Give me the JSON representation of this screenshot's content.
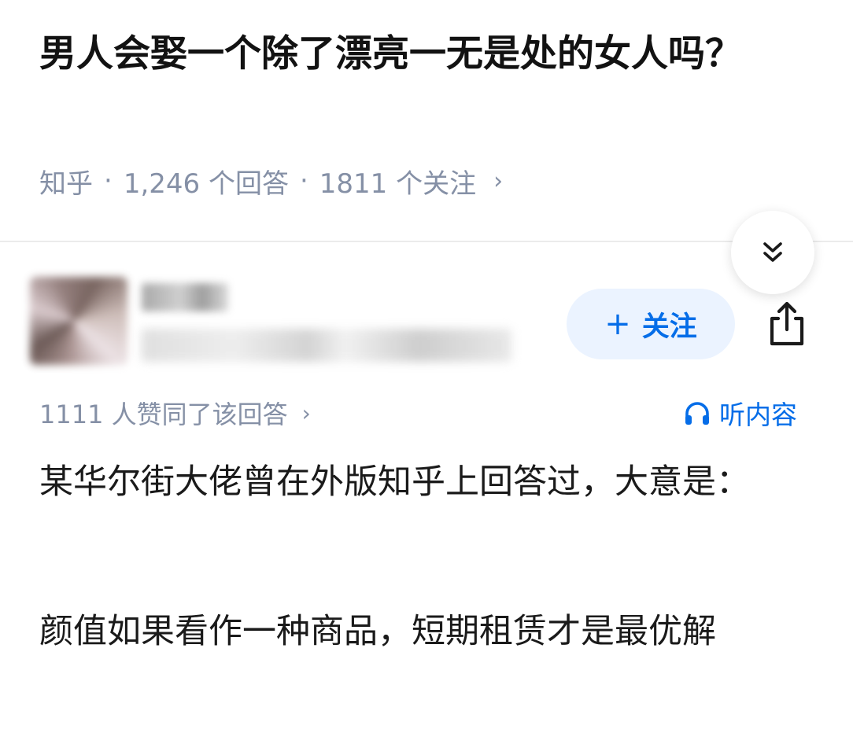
{
  "question": {
    "title": "男人会娶一个除了漂亮一无是处的女人吗？",
    "meta": {
      "source": "知乎",
      "answers": "1,246 个回答",
      "followers": "1811 个关注"
    }
  },
  "author": {
    "follow_label": "关注"
  },
  "answer": {
    "votes_text": "1111 人赞同了该回答",
    "listen_label": "听内容",
    "paragraphs": [
      "某华尔街大佬曾在外版知乎上回答过，大意是：",
      "颜值如果看作一种商品，短期租赁才是最优解"
    ]
  },
  "icons": {
    "collapse": "double-chevron-down-icon",
    "share": "share-icon",
    "listen": "headphones-icon"
  },
  "colors": {
    "accent": "#056de8",
    "muted": "#8590a6",
    "follow_bg": "#ebf3ff"
  }
}
